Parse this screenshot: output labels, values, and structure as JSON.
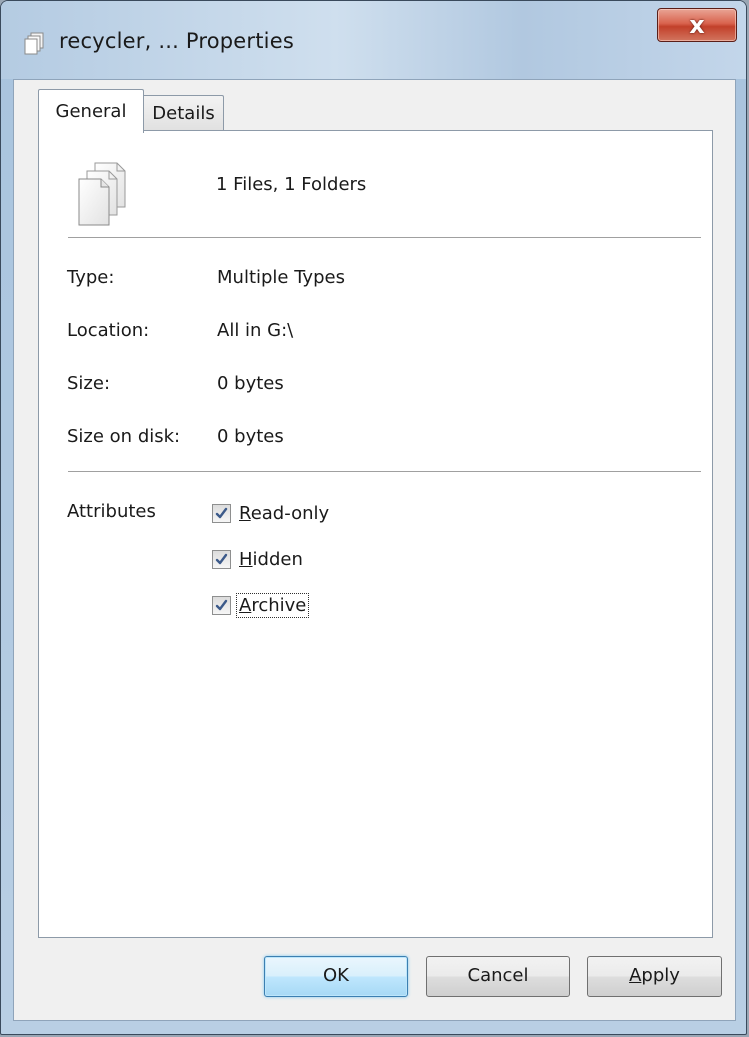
{
  "window": {
    "title": "recycler, ... Properties",
    "close_label": "x"
  },
  "tabs": [
    {
      "label": "General",
      "active": true
    },
    {
      "label": "Details",
      "active": false
    }
  ],
  "general": {
    "summary": "1 Files, 1 Folders",
    "fields": {
      "type_label": "Type:",
      "type_value": "Multiple Types",
      "location_label": "Location:",
      "location_value": "All in G:\\",
      "size_label": "Size:",
      "size_value": "0 bytes",
      "size_on_disk_label": "Size on disk:",
      "size_on_disk_value": "0 bytes"
    },
    "attributes": {
      "label": "Attributes",
      "items": [
        {
          "accel": "R",
          "rest": "ead-only",
          "checked": true
        },
        {
          "accel": "H",
          "rest": "idden",
          "checked": true
        },
        {
          "accel": "A",
          "rest": "rchive",
          "checked": true
        }
      ]
    }
  },
  "buttons": {
    "ok": "OK",
    "cancel": "Cancel",
    "apply_accel": "A",
    "apply_rest": "pply"
  },
  "colors": {
    "check_mark": "#3c5a8a",
    "close_button": "#c2402a",
    "default_button_border": "#3c7fb1"
  },
  "icons": {
    "title": "multiple-files-icon",
    "summary": "multiple-files-icon",
    "check": "check-mark-icon"
  }
}
